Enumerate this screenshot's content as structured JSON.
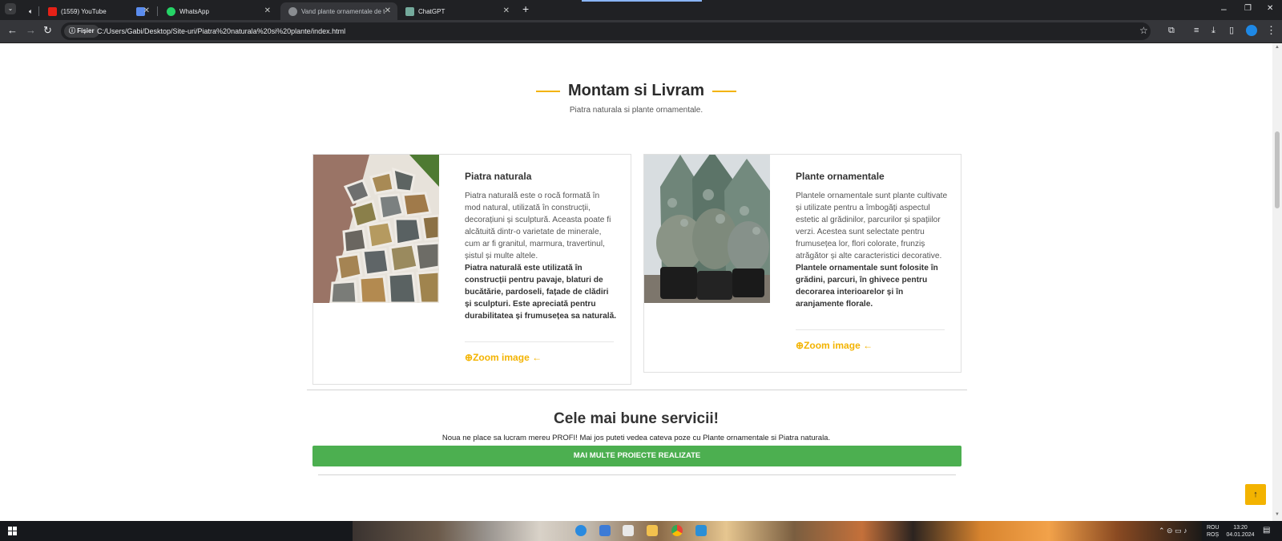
{
  "browser": {
    "tabs": [
      {
        "label": "(1559) YouTube",
        "active": false
      },
      {
        "label": "",
        "active": false
      },
      {
        "label": "WhatsApp",
        "active": false
      },
      {
        "label": "Vand plante ornamentale de to",
        "active": true
      },
      {
        "label": "ChatGPT",
        "active": false
      }
    ],
    "site_chip": "Fișier",
    "url": "C:/Users/Gabi/Desktop/Site-uri/Piatra%20naturala%20si%20plante/index.html"
  },
  "section": {
    "title": "Montam si Livram",
    "subtitle": "Piatra naturala si plante ornamentale."
  },
  "cards": [
    {
      "title": "Piatra naturala",
      "text": "Piatra naturală este o rocă formată în mod natural, utilizată în construcții, decorațiuni și sculptură. Aceasta poate fi alcătuită dintr-o varietate de minerale, cum ar fi granitul, marmura, travertinul, șistul și multe altele.",
      "bold": "Piatra naturală este utilizată în construcții pentru pavaje, blaturi de bucătărie, pardoseli, fațade de clădiri și sculpturi. Este apreciată pentru durabilitatea și frumusețea sa naturală.",
      "zoom_label": "Zoom image"
    },
    {
      "title": "Plante ornamentale",
      "text": "Plantele ornamentale sunt plante cultivate și utilizate pentru a îmbogăți aspectul estetic al grădinilor, parcurilor și spațiilor verzi. Acestea sunt selectate pentru frumusețea lor, flori colorate, frunziș atrăgător și alte caracteristici decorative.",
      "bold": "Plantele ornamentale sunt folosite în grădini, parcuri, în ghivece pentru decorarea interioarelor și în aranjamente florale.",
      "zoom_label": "Zoom image"
    }
  ],
  "services": {
    "title": "Cele mai bune servicii!",
    "text": "Noua ne place sa lucram mereu PROFI! Mai jos puteti vedea cateva poze cu Plante ornamentale si Piatra naturala.",
    "button": "MAI MULTE PROIECTE REALIZATE"
  },
  "taskbar": {
    "lang_top": "ROU",
    "lang_bottom": "ROȘ",
    "time": "13:20",
    "date": "04.01.2024"
  },
  "colors": {
    "accent": "#f3b300",
    "button_green": "#4caf50"
  }
}
